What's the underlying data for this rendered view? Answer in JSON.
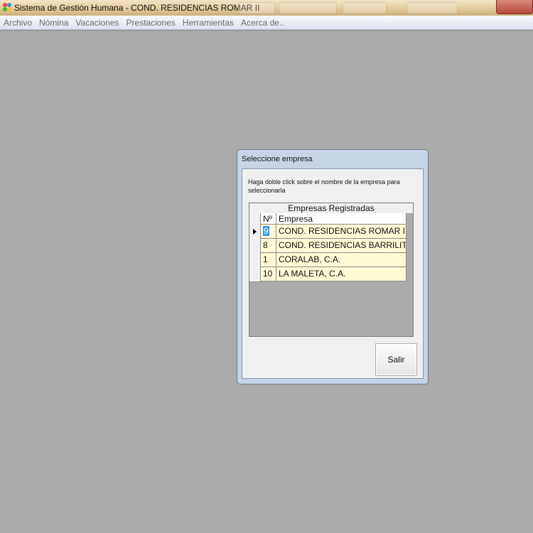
{
  "window": {
    "title": "Sistema de Gestión Humana - COND. RESIDENCIAS  ROMAR II"
  },
  "menu": {
    "items": [
      "Archivo",
      "Nómina",
      "Vacaciones",
      "Prestaciones",
      "Herramientas",
      "Acerca de.."
    ]
  },
  "dialog": {
    "title": "Seleccione empresa",
    "instruction": "Haga doble click sobre el nombre de la empresa para seleccionarla",
    "grid": {
      "caption": "Empresas Registradas",
      "columns": [
        "Nº",
        "Empresa"
      ],
      "rows": [
        {
          "num": "9",
          "empresa": "COND. RESIDENCIAS  ROMAR II",
          "current": true
        },
        {
          "num": "8",
          "empresa": "COND. RESIDENCIAS BARRILITO"
        },
        {
          "num": "1",
          "empresa": "CORALAB, C.A."
        },
        {
          "num": "10",
          "empresa": "LA MALETA, C.A."
        }
      ]
    },
    "exit_label": "Salir"
  },
  "colors": {
    "workspace": "#ababab",
    "row_background": "#fff9d4",
    "selection": "#3399ff"
  }
}
